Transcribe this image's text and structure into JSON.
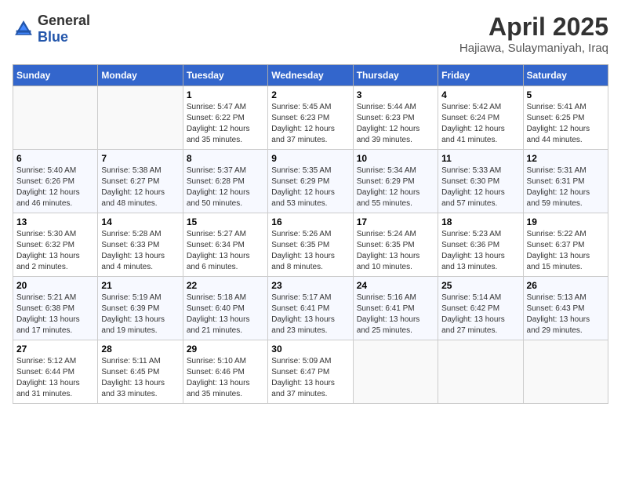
{
  "header": {
    "logo_general": "General",
    "logo_blue": "Blue",
    "month": "April 2025",
    "location": "Hajiawa, Sulaymaniyah, Iraq"
  },
  "weekdays": [
    "Sunday",
    "Monday",
    "Tuesday",
    "Wednesday",
    "Thursday",
    "Friday",
    "Saturday"
  ],
  "weeks": [
    [
      {
        "date": "",
        "sunrise": "",
        "sunset": "",
        "daylight": ""
      },
      {
        "date": "",
        "sunrise": "",
        "sunset": "",
        "daylight": ""
      },
      {
        "date": "1",
        "sunrise": "Sunrise: 5:47 AM",
        "sunset": "Sunset: 6:22 PM",
        "daylight": "Daylight: 12 hours and 35 minutes."
      },
      {
        "date": "2",
        "sunrise": "Sunrise: 5:45 AM",
        "sunset": "Sunset: 6:23 PM",
        "daylight": "Daylight: 12 hours and 37 minutes."
      },
      {
        "date": "3",
        "sunrise": "Sunrise: 5:44 AM",
        "sunset": "Sunset: 6:23 PM",
        "daylight": "Daylight: 12 hours and 39 minutes."
      },
      {
        "date": "4",
        "sunrise": "Sunrise: 5:42 AM",
        "sunset": "Sunset: 6:24 PM",
        "daylight": "Daylight: 12 hours and 41 minutes."
      },
      {
        "date": "5",
        "sunrise": "Sunrise: 5:41 AM",
        "sunset": "Sunset: 6:25 PM",
        "daylight": "Daylight: 12 hours and 44 minutes."
      }
    ],
    [
      {
        "date": "6",
        "sunrise": "Sunrise: 5:40 AM",
        "sunset": "Sunset: 6:26 PM",
        "daylight": "Daylight: 12 hours and 46 minutes."
      },
      {
        "date": "7",
        "sunrise": "Sunrise: 5:38 AM",
        "sunset": "Sunset: 6:27 PM",
        "daylight": "Daylight: 12 hours and 48 minutes."
      },
      {
        "date": "8",
        "sunrise": "Sunrise: 5:37 AM",
        "sunset": "Sunset: 6:28 PM",
        "daylight": "Daylight: 12 hours and 50 minutes."
      },
      {
        "date": "9",
        "sunrise": "Sunrise: 5:35 AM",
        "sunset": "Sunset: 6:29 PM",
        "daylight": "Daylight: 12 hours and 53 minutes."
      },
      {
        "date": "10",
        "sunrise": "Sunrise: 5:34 AM",
        "sunset": "Sunset: 6:29 PM",
        "daylight": "Daylight: 12 hours and 55 minutes."
      },
      {
        "date": "11",
        "sunrise": "Sunrise: 5:33 AM",
        "sunset": "Sunset: 6:30 PM",
        "daylight": "Daylight: 12 hours and 57 minutes."
      },
      {
        "date": "12",
        "sunrise": "Sunrise: 5:31 AM",
        "sunset": "Sunset: 6:31 PM",
        "daylight": "Daylight: 12 hours and 59 minutes."
      }
    ],
    [
      {
        "date": "13",
        "sunrise": "Sunrise: 5:30 AM",
        "sunset": "Sunset: 6:32 PM",
        "daylight": "Daylight: 13 hours and 2 minutes."
      },
      {
        "date": "14",
        "sunrise": "Sunrise: 5:28 AM",
        "sunset": "Sunset: 6:33 PM",
        "daylight": "Daylight: 13 hours and 4 minutes."
      },
      {
        "date": "15",
        "sunrise": "Sunrise: 5:27 AM",
        "sunset": "Sunset: 6:34 PM",
        "daylight": "Daylight: 13 hours and 6 minutes."
      },
      {
        "date": "16",
        "sunrise": "Sunrise: 5:26 AM",
        "sunset": "Sunset: 6:35 PM",
        "daylight": "Daylight: 13 hours and 8 minutes."
      },
      {
        "date": "17",
        "sunrise": "Sunrise: 5:24 AM",
        "sunset": "Sunset: 6:35 PM",
        "daylight": "Daylight: 13 hours and 10 minutes."
      },
      {
        "date": "18",
        "sunrise": "Sunrise: 5:23 AM",
        "sunset": "Sunset: 6:36 PM",
        "daylight": "Daylight: 13 hours and 13 minutes."
      },
      {
        "date": "19",
        "sunrise": "Sunrise: 5:22 AM",
        "sunset": "Sunset: 6:37 PM",
        "daylight": "Daylight: 13 hours and 15 minutes."
      }
    ],
    [
      {
        "date": "20",
        "sunrise": "Sunrise: 5:21 AM",
        "sunset": "Sunset: 6:38 PM",
        "daylight": "Daylight: 13 hours and 17 minutes."
      },
      {
        "date": "21",
        "sunrise": "Sunrise: 5:19 AM",
        "sunset": "Sunset: 6:39 PM",
        "daylight": "Daylight: 13 hours and 19 minutes."
      },
      {
        "date": "22",
        "sunrise": "Sunrise: 5:18 AM",
        "sunset": "Sunset: 6:40 PM",
        "daylight": "Daylight: 13 hours and 21 minutes."
      },
      {
        "date": "23",
        "sunrise": "Sunrise: 5:17 AM",
        "sunset": "Sunset: 6:41 PM",
        "daylight": "Daylight: 13 hours and 23 minutes."
      },
      {
        "date": "24",
        "sunrise": "Sunrise: 5:16 AM",
        "sunset": "Sunset: 6:41 PM",
        "daylight": "Daylight: 13 hours and 25 minutes."
      },
      {
        "date": "25",
        "sunrise": "Sunrise: 5:14 AM",
        "sunset": "Sunset: 6:42 PM",
        "daylight": "Daylight: 13 hours and 27 minutes."
      },
      {
        "date": "26",
        "sunrise": "Sunrise: 5:13 AM",
        "sunset": "Sunset: 6:43 PM",
        "daylight": "Daylight: 13 hours and 29 minutes."
      }
    ],
    [
      {
        "date": "27",
        "sunrise": "Sunrise: 5:12 AM",
        "sunset": "Sunset: 6:44 PM",
        "daylight": "Daylight: 13 hours and 31 minutes."
      },
      {
        "date": "28",
        "sunrise": "Sunrise: 5:11 AM",
        "sunset": "Sunset: 6:45 PM",
        "daylight": "Daylight: 13 hours and 33 minutes."
      },
      {
        "date": "29",
        "sunrise": "Sunrise: 5:10 AM",
        "sunset": "Sunset: 6:46 PM",
        "daylight": "Daylight: 13 hours and 35 minutes."
      },
      {
        "date": "30",
        "sunrise": "Sunrise: 5:09 AM",
        "sunset": "Sunset: 6:47 PM",
        "daylight": "Daylight: 13 hours and 37 minutes."
      },
      {
        "date": "",
        "sunrise": "",
        "sunset": "",
        "daylight": ""
      },
      {
        "date": "",
        "sunrise": "",
        "sunset": "",
        "daylight": ""
      },
      {
        "date": "",
        "sunrise": "",
        "sunset": "",
        "daylight": ""
      }
    ]
  ]
}
